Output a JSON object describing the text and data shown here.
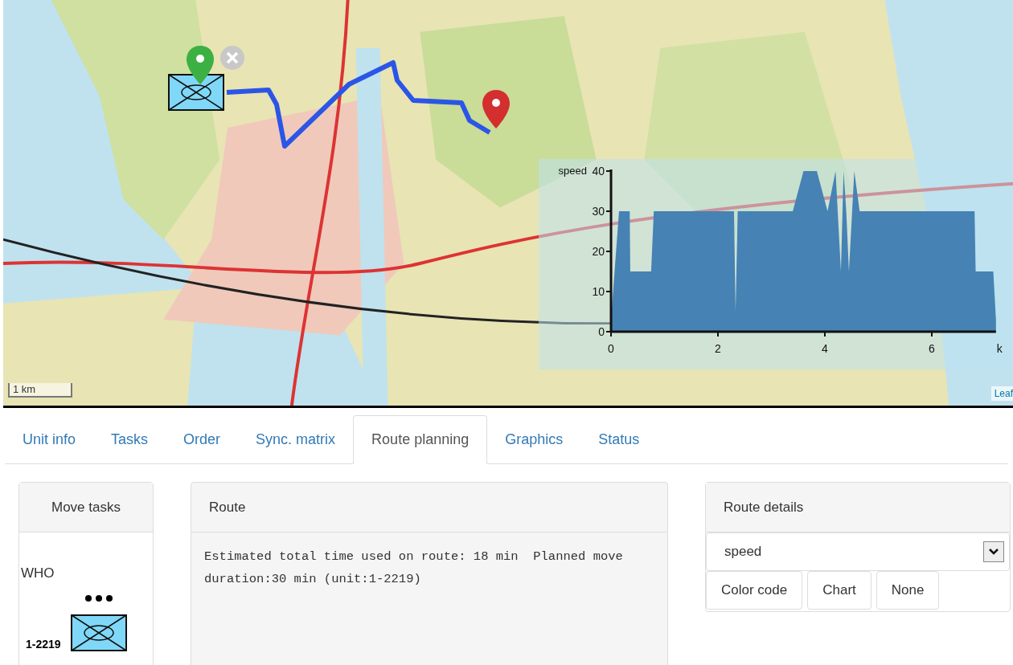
{
  "map": {
    "scale_label": "1 km",
    "attribution": "Leaf",
    "chart_data": {
      "type": "area",
      "ylabel": "speed",
      "xlabel": "k",
      "xlim": [
        0,
        7.2
      ],
      "ylim": [
        0,
        40
      ],
      "xticks": [
        0,
        2,
        4,
        6
      ],
      "yticks": [
        0,
        10,
        20,
        30,
        40
      ],
      "x": [
        0,
        0.15,
        0.35,
        0.36,
        0.75,
        0.8,
        2.3,
        2.33,
        2.37,
        2.4,
        3.4,
        3.6,
        3.85,
        4.05,
        4.2,
        4.3,
        4.35,
        4.4,
        4.45,
        4.55,
        4.65,
        6.8,
        6.82,
        7.15,
        7.2
      ],
      "series": [
        {
          "color": "#4682b4",
          "values": [
            3,
            30,
            30,
            15,
            15,
            30,
            30,
            5,
            30,
            30,
            30,
            40,
            40,
            30,
            40,
            15,
            40,
            30,
            15,
            40,
            30,
            30,
            15,
            15,
            3
          ]
        }
      ]
    }
  },
  "tabs": [
    {
      "label": "Unit info",
      "selected": false
    },
    {
      "label": "Tasks",
      "selected": false
    },
    {
      "label": "Order",
      "selected": false
    },
    {
      "label": "Sync. matrix",
      "selected": false
    },
    {
      "label": "Route planning",
      "selected": true
    },
    {
      "label": "Graphics",
      "selected": false
    },
    {
      "label": "Status",
      "selected": false
    }
  ],
  "move_tasks": {
    "title": "Move tasks",
    "who_label": "WHO",
    "unit_id": "1-2219"
  },
  "route": {
    "title": "Route",
    "text": "Estimated total time used on route: 18 min  Planned move duration:30 min (unit:1-2219)"
  },
  "route_details": {
    "title": "Route details",
    "select_value": "speed",
    "buttons": [
      "Color code",
      "Chart",
      "None"
    ]
  }
}
